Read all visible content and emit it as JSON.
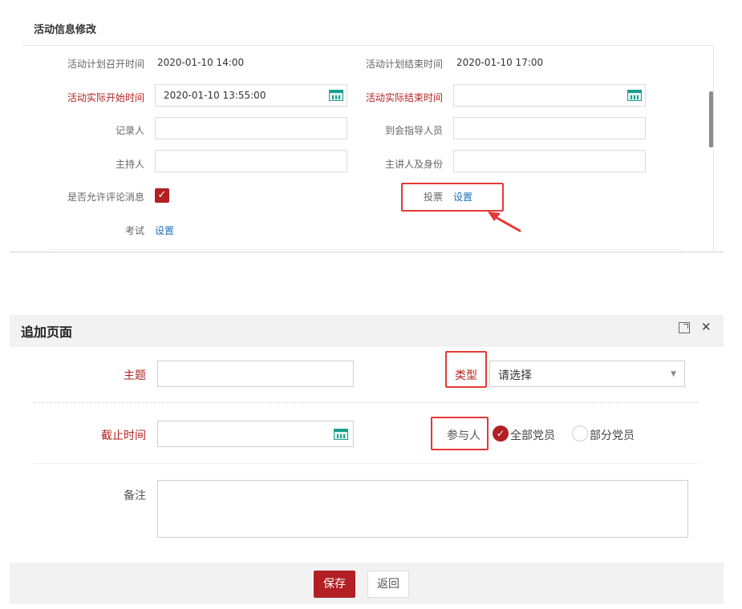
{
  "top_panel": {
    "title": "活动信息修改",
    "plan_start_label": "活动计划召开时间",
    "plan_start_value": "2020-01-10 14:00",
    "plan_end_label": "活动计划结束时间",
    "plan_end_value": "2020-01-10 17:00",
    "actual_start_label": "活动实际开始时间",
    "actual_start_value": "2020-01-10 13:55:00",
    "actual_end_label": "活动实际结束时间",
    "actual_end_value": "",
    "recorder_label": "记录人",
    "recorder_value": "",
    "guide_label": "到会指导人员",
    "guide_value": "",
    "host_label": "主持人",
    "host_value": "",
    "speaker_label": "主讲人及身份",
    "speaker_value": "",
    "allow_comment_label": "是否允许评论消息",
    "allow_comment_checked": true,
    "vote_label": "投票",
    "vote_link": "设置",
    "exam_label": "考试",
    "exam_link": "设置",
    "highlight_color": "#e53935"
  },
  "dialog": {
    "title": "追加页面",
    "subject_label": "主题",
    "subject_value": "",
    "type_label": "类型",
    "type_placeholder": "请选择",
    "deadline_label": "截止时间",
    "deadline_value": "",
    "participants_label": "参与人",
    "participant_options": [
      "全部党员",
      "部分党员"
    ],
    "participant_selected": "全部党员",
    "notes_label": "备注",
    "notes_value": "",
    "save_label": "保存",
    "back_label": "返回",
    "accent_color": "#b21f24"
  }
}
